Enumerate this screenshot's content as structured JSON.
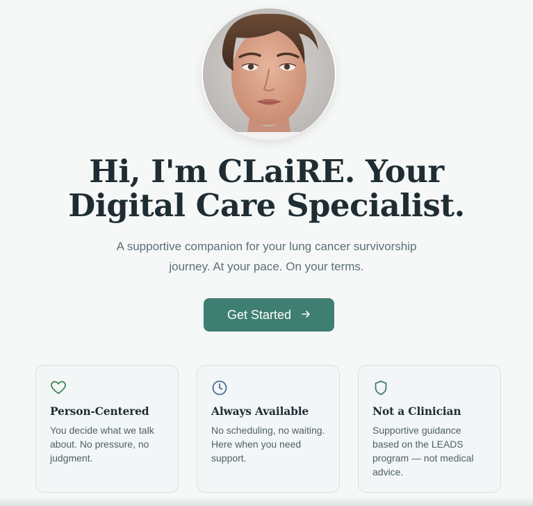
{
  "hero": {
    "title": "Hi, I'm CLaiRE. Your Digital Care Specialist.",
    "subtitle": "A supportive companion for your lung cancer survivorship journey. At your pace. On your terms.",
    "cta_label": "Get Started",
    "cta_icon": "arrow-right-icon"
  },
  "features": [
    {
      "icon": "heart-icon",
      "title": "Person-Centered",
      "text": "You decide what we talk about. No pressure, no judgment."
    },
    {
      "icon": "clock-icon",
      "title": "Always Available",
      "text": "No scheduling, no waiting. Here when you need support."
    },
    {
      "icon": "shield-icon",
      "title": "Not a Clinician",
      "text": "Supportive guidance based on the LEADS program — not medical advice."
    }
  ],
  "colors": {
    "background": "#f6f8f7",
    "accent": "#3f7f72",
    "heading": "#1f2d33",
    "body_text": "#5c6f78",
    "heart_icon": "#3f8a55",
    "clock_icon": "#4a6a9a",
    "shield_icon": "#3f7f72"
  }
}
